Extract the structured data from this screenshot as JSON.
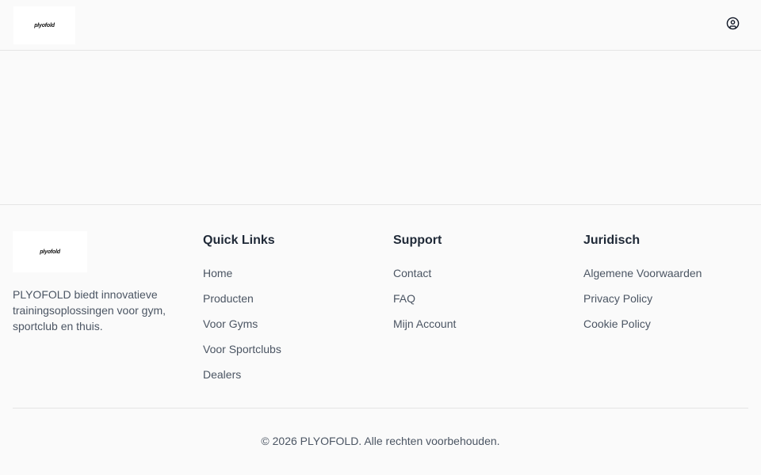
{
  "header": {
    "logo_text": "plyofold",
    "account_icon": "user-circle-icon"
  },
  "footer": {
    "logo_text": "plyofold",
    "description": "PLYOFOLD biedt innovatieve trainingsoplossingen voor gym, sportclub en thuis.",
    "quick_links": {
      "title": "Quick Links",
      "items": [
        "Home",
        "Producten",
        "Voor Gyms",
        "Voor Sportclubs",
        "Dealers"
      ]
    },
    "support": {
      "title": "Support",
      "items": [
        "Contact",
        "FAQ",
        "Mijn Account"
      ]
    },
    "legal": {
      "title": "Juridisch",
      "items": [
        "Algemene Voorwaarden",
        "Privacy Policy",
        "Cookie Policy"
      ]
    },
    "copyright": "© 2026 PLYOFOLD. Alle rechten voorbehouden."
  }
}
